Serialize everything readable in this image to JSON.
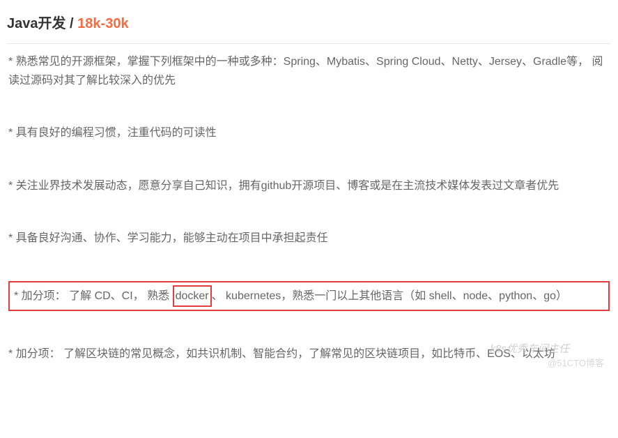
{
  "header": {
    "title": "Java开发 / ",
    "salary": "18k-30k"
  },
  "requirements": [
    "* 熟悉常见的开源框架，掌握下列框架中的一种或多种：Spring、Mybatis、Spring Cloud、Netty、Jersey、Gradle等， 阅读过源码对其了解比较深入的优先",
    "* 具有良好的编程习惯，注重代码的可读性",
    "* 关注业界技术发展动态，愿意分享自己知识，拥有github开源项目、博客或是在主流技术媒体发表过文章者优先",
    "* 具备良好沟通、协作、学习能力，能够主动在项目中承担起责任"
  ],
  "highlighted": {
    "prefix": "* 加分项： 了解 CD、CI， 熟悉 ",
    "docker": "docker",
    "suffix": "、 kubernetes，熟悉一门以上其他语言（如 shell、node、python、go）"
  },
  "lastRequirement": "* 加分项： 了解区块链的常见概念，如共识机制、智能合约，了解常见的区块链项目，如比特币、EOS、以太坊",
  "watermarks": {
    "wechat": "k8s优秀车间主任",
    "blog": "@51CTO博客"
  }
}
